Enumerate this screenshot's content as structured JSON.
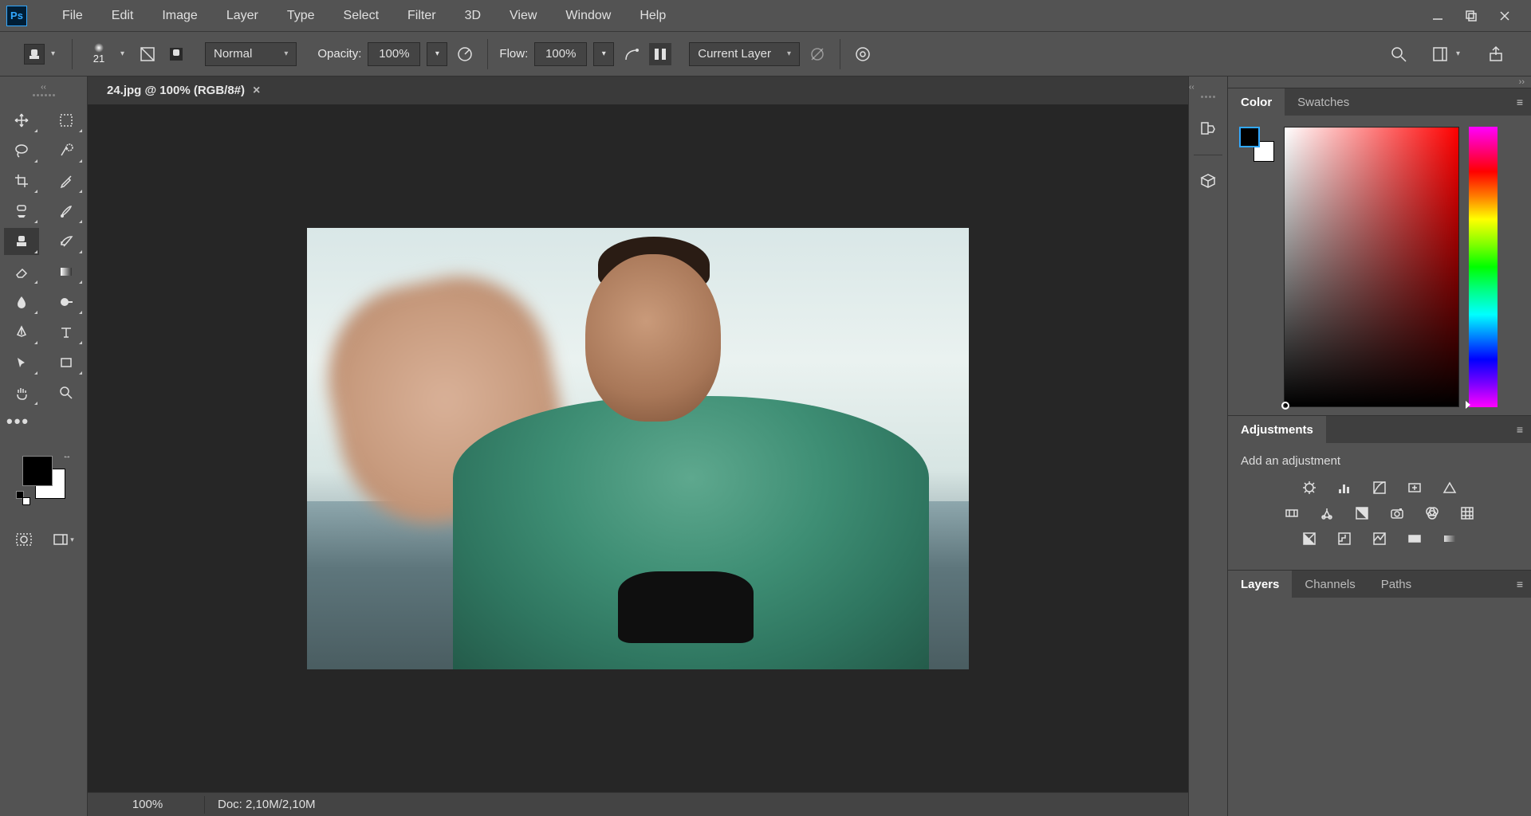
{
  "app": {
    "logo_text": "Ps"
  },
  "menu": {
    "items": [
      "File",
      "Edit",
      "Image",
      "Layer",
      "Type",
      "Select",
      "Filter",
      "3D",
      "View",
      "Window",
      "Help"
    ]
  },
  "options": {
    "brush_size": "21",
    "mode_label": "Normal",
    "opacity_label": "Opacity:",
    "opacity_value": "100%",
    "flow_label": "Flow:",
    "flow_value": "100%",
    "sample_label": "Current Layer"
  },
  "document": {
    "tab_title": "24.jpg @ 100% (RGB/8#)",
    "zoom": "100%",
    "doc_info": "Doc: 2,10M/2,10M"
  },
  "panels": {
    "color": {
      "tabs": [
        "Color",
        "Swatches"
      ],
      "active": 0
    },
    "adjustments": {
      "tabs": [
        "Adjustments"
      ],
      "active": 0,
      "subtitle": "Add an adjustment"
    },
    "layers": {
      "tabs": [
        "Layers",
        "Channels",
        "Paths"
      ],
      "active": 0
    }
  },
  "tools": [
    [
      "move-tool",
      "marquee-tool"
    ],
    [
      "lasso-tool",
      "quick-select-tool"
    ],
    [
      "crop-tool",
      "eyedropper-tool"
    ],
    [
      "healing-brush-tool",
      "brush-tool"
    ],
    [
      "clone-stamp-tool",
      "history-brush-tool"
    ],
    [
      "eraser-tool",
      "gradient-tool"
    ],
    [
      "blur-tool",
      "dodge-tool"
    ],
    [
      "pen-tool",
      "type-tool"
    ],
    [
      "path-select-tool",
      "rectangle-tool"
    ],
    [
      "hand-tool",
      "zoom-tool"
    ]
  ]
}
